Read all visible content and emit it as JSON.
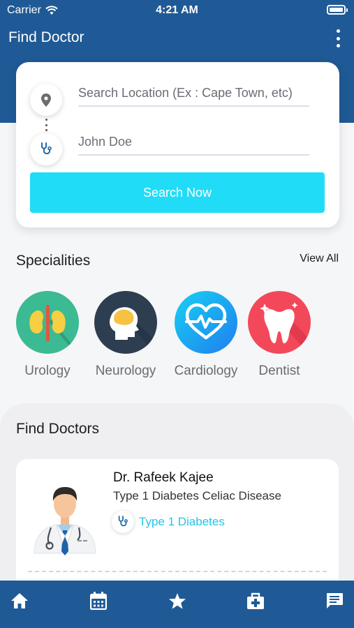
{
  "status_bar": {
    "carrier": "Carrier",
    "time": "4:21 AM"
  },
  "header": {
    "title": "Find Doctor",
    "menu_icon": "more-vertical-icon"
  },
  "search": {
    "location_placeholder": "Search Location (Ex : Cape Town, etc)",
    "location_icon": "location-pin-icon",
    "doctor_name_value": "John Doe",
    "doctor_icon": "stethoscope-icon",
    "button_label": "Search Now",
    "button_color": "#21dcf7"
  },
  "specialities": {
    "title": "Specialities",
    "view_all_label": "View All",
    "items": [
      {
        "label": "Urology",
        "icon": "kidney-icon",
        "color": "#3cba93"
      },
      {
        "label": "Neurology",
        "icon": "brain-icon",
        "color": "#2d3e50"
      },
      {
        "label": "Cardiology",
        "icon": "heart-icon",
        "color": "#1fa6f0"
      },
      {
        "label": "Dentist",
        "icon": "tooth-icon",
        "color": "#f3485a"
      }
    ]
  },
  "find_doctors": {
    "title": "Find Doctors",
    "doctors": [
      {
        "name": "Dr. Rafeek Kajee",
        "description": "Type 1 Diabetes Celiac Disease",
        "tag": "Type 1 Diabetes",
        "avatar_icon": "doctor-avatar-icon"
      }
    ]
  },
  "bottom_nav": {
    "items": [
      {
        "icon": "home-icon"
      },
      {
        "icon": "calendar-icon"
      },
      {
        "icon": "star-icon"
      },
      {
        "icon": "medical-bag-icon"
      },
      {
        "icon": "chat-icon"
      }
    ]
  },
  "colors": {
    "primary": "#1f5a96",
    "accent": "#21dcf7",
    "tag_text": "#23c5e8"
  }
}
